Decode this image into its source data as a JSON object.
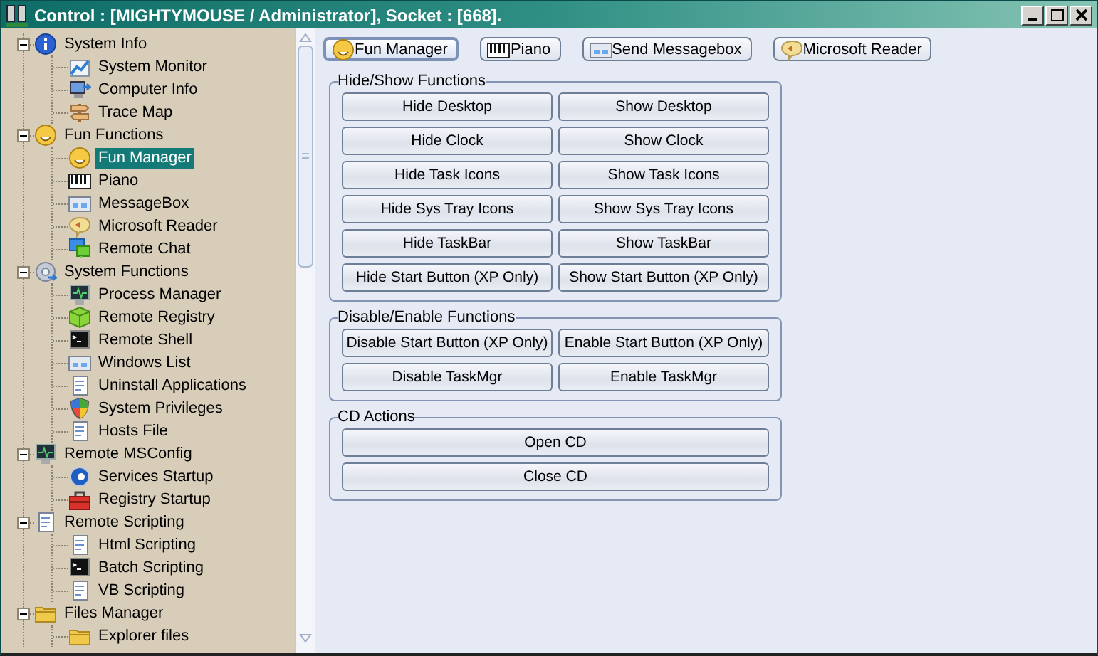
{
  "window": {
    "title": "Control : [MIGHTYMOUSE / Administrator], Socket : [668]."
  },
  "tree": [
    {
      "label": "System Info",
      "expanded": true,
      "children": [
        {
          "label": "System Monitor",
          "selected": false
        },
        {
          "label": "Computer Info",
          "selected": false
        },
        {
          "label": "Trace Map",
          "selected": false
        }
      ]
    },
    {
      "label": "Fun Functions",
      "expanded": true,
      "children": [
        {
          "label": "Fun Manager",
          "selected": true
        },
        {
          "label": "Piano",
          "selected": false
        },
        {
          "label": "MessageBox",
          "selected": false
        },
        {
          "label": "Microsoft Reader",
          "selected": false
        },
        {
          "label": "Remote Chat",
          "selected": false
        }
      ]
    },
    {
      "label": "System Functions",
      "expanded": true,
      "children": [
        {
          "label": "Process Manager",
          "selected": false
        },
        {
          "label": "Remote Registry",
          "selected": false
        },
        {
          "label": "Remote Shell",
          "selected": false
        },
        {
          "label": "Windows List",
          "selected": false
        },
        {
          "label": "Uninstall Applications",
          "selected": false
        },
        {
          "label": "System Privileges",
          "selected": false
        },
        {
          "label": "Hosts File",
          "selected": false
        }
      ]
    },
    {
      "label": "Remote MSConfig",
      "expanded": true,
      "children": [
        {
          "label": "Services Startup",
          "selected": false
        },
        {
          "label": "Registry Startup",
          "selected": false
        }
      ]
    },
    {
      "label": "Remote Scripting",
      "expanded": true,
      "children": [
        {
          "label": "Html Scripting",
          "selected": false
        },
        {
          "label": "Batch Scripting",
          "selected": false
        },
        {
          "label": "VB Scripting",
          "selected": false
        }
      ]
    },
    {
      "label": "Files Manager",
      "expanded": true,
      "children": [
        {
          "label": "Explorer files",
          "selected": false
        }
      ]
    }
  ],
  "tabs": [
    {
      "label": "Fun Manager",
      "selected": true
    },
    {
      "label": "Piano",
      "selected": false
    },
    {
      "label": "Send Messagebox",
      "selected": false
    },
    {
      "label": "Microsoft Reader",
      "selected": false
    }
  ],
  "groups": [
    {
      "title": "Hide/Show Functions",
      "kind": "paired",
      "buttons": [
        "Hide Desktop",
        "Show Desktop",
        "Hide Clock",
        "Show Clock",
        "Hide Task Icons",
        "Show Task Icons",
        "Hide Sys Tray Icons",
        "Show Sys Tray Icons",
        "Hide TaskBar",
        "Show TaskBar",
        "Hide Start Button (XP Only)",
        "Show Start Button (XP Only)"
      ]
    },
    {
      "title": "Disable/Enable Functions",
      "kind": "paired",
      "buttons": [
        "Disable Start Button (XP Only)",
        "Enable Start Button (XP Only)",
        "Disable TaskMgr",
        "Enable TaskMgr"
      ]
    },
    {
      "title": "CD Actions",
      "kind": "wide",
      "buttons": [
        "Open CD",
        "Close CD"
      ]
    }
  ]
}
